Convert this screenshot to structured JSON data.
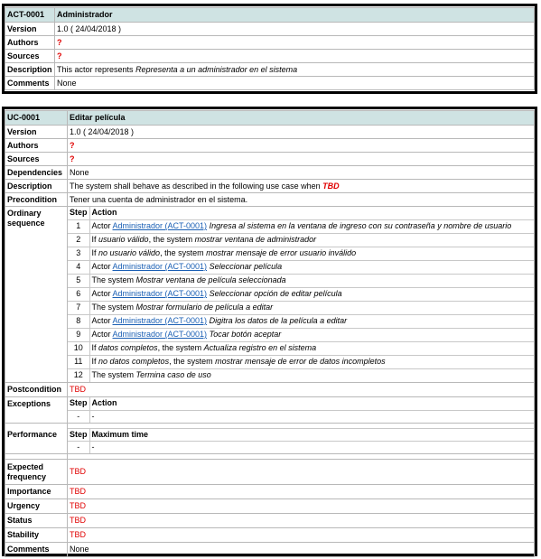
{
  "actor": {
    "id": "ACT-0001",
    "name": "Administrador",
    "version_label": "Version",
    "version_value": "1.0 ( 24/04/2018 )",
    "authors_label": "Authors",
    "authors_value": "?",
    "sources_label": "Sources",
    "sources_value": "?",
    "description_label": "Description",
    "description_prefix": "This actor represents",
    "description_italic": "Representa a un administrador en el sistema",
    "comments_label": "Comments",
    "comments_value": "None"
  },
  "usecase": {
    "id": "UC-0001",
    "name": "Editar película",
    "version_label": "Version",
    "version_value": "1.0 ( 24/04/2018 )",
    "authors_label": "Authors",
    "authors_value": "?",
    "sources_label": "Sources",
    "sources_value": "?",
    "dependencies_label": "Dependencies",
    "dependencies_value": "None",
    "description_label": "Description",
    "description_prefix": "The system shall behave as described in the following use case when",
    "description_tbd": "TBD",
    "precondition_label": "Precondition",
    "precondition_value": "Tener una cuenta de administrador en el sistema.",
    "sequence_label_1": "Ordinary",
    "sequence_label_2": "sequence",
    "step_header": "Step",
    "action_header": "Action",
    "steps": [
      {
        "n": "1",
        "pre": "Actor ",
        "link": "Administrador (ACT-0001)",
        "mid": "",
        "it": "Ingresa al sistema en la ventana de ingreso con su contraseña y nombre de usuario"
      },
      {
        "n": "2",
        "pre": "If ",
        "link": "",
        "mid": "usuario válido",
        "post": ", the system ",
        "it": "mostrar ventana de administrador"
      },
      {
        "n": "3",
        "pre": "If ",
        "link": "",
        "mid": "no usuario válido",
        "post": ", the system ",
        "it": "mostrar mensaje de error usuario inválido"
      },
      {
        "n": "4",
        "pre": "Actor ",
        "link": "Administrador (ACT-0001)",
        "mid": "",
        "it": "Seleccionar película"
      },
      {
        "n": "5",
        "pre": "The system ",
        "link": "",
        "mid": "",
        "it": "Mostrar ventana de película seleccionada"
      },
      {
        "n": "6",
        "pre": "Actor ",
        "link": "Administrador (ACT-0001)",
        "mid": "",
        "it": "Seleccionar opción de editar película"
      },
      {
        "n": "7",
        "pre": "The system ",
        "link": "",
        "mid": "",
        "it": "Mostrar formulario de película a editar"
      },
      {
        "n": "8",
        "pre": "Actor ",
        "link": "Administrador (ACT-0001)",
        "mid": "",
        "it": "Digitra los datos de la película a editar"
      },
      {
        "n": "9",
        "pre": "Actor ",
        "link": "Administrador (ACT-0001)",
        "mid": "",
        "it": "Tocar botón aceptar"
      },
      {
        "n": "10",
        "pre": "If ",
        "link": "",
        "mid": "datos completos",
        "post": ", the system ",
        "it": "Actualiza registro en el sistema"
      },
      {
        "n": "11",
        "pre": "If ",
        "link": "",
        "mid": "no datos completos",
        "post": ", the system ",
        "it": "mostrar mensaje de error de datos incompletos"
      },
      {
        "n": "12",
        "pre": "The system ",
        "link": "",
        "mid": "",
        "it": "Termina caso de uso"
      }
    ],
    "postcondition_label": "Postcondition",
    "postcondition_value": "TBD",
    "exceptions_label": "Exceptions",
    "exceptions_action_header": "Action",
    "exceptions_row_step": "-",
    "exceptions_row_action": "-",
    "performance_label": "Performance",
    "performance_header": "Maximum time",
    "performance_row_step": "-",
    "performance_row_value": "-",
    "frequency_label_1": "Expected",
    "frequency_label_2": "frequency",
    "frequency_value": "TBD",
    "importance_label": "Importance",
    "importance_value": "TBD",
    "urgency_label": "Urgency",
    "urgency_value": "TBD",
    "status_label": "Status",
    "status_value": "TBD",
    "stability_label": "Stability",
    "stability_value": "TBD",
    "comments_label": "Comments",
    "comments_value": "None"
  }
}
